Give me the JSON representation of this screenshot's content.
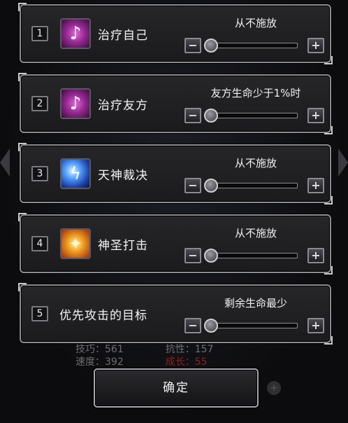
{
  "background": {
    "stats_left_1": "技巧：561",
    "stats_right_1": "抗性：157",
    "stats_left_2": "速度：392",
    "stats_right_2": "成长：55"
  },
  "rows": [
    {
      "number": "1",
      "icon": "heal-self-icon",
      "name": "治疗自己",
      "status": "从不施放",
      "level": 0
    },
    {
      "number": "2",
      "icon": "heal-ally-icon",
      "name": "治疗友方",
      "status": "友方生命少于1%时",
      "level": 0
    },
    {
      "number": "3",
      "icon": "divine-judgment-icon",
      "name": "天神裁决",
      "status": "从不施放",
      "level": 0
    },
    {
      "number": "4",
      "icon": "holy-strike-icon",
      "name": "神圣打击",
      "status": "从不施放",
      "level": 0
    },
    {
      "number": "5",
      "icon": null,
      "name": "优先攻击的目标",
      "status": "剩余生命最少",
      "level": 0
    }
  ],
  "confirm_label": "确定",
  "colors": {
    "panel_border": "#8c8c92",
    "panel_bg": "#262629",
    "heal_icon": "#9a2a96",
    "judge_icon": "#58a6ff",
    "strike_icon": "#f0a020"
  }
}
